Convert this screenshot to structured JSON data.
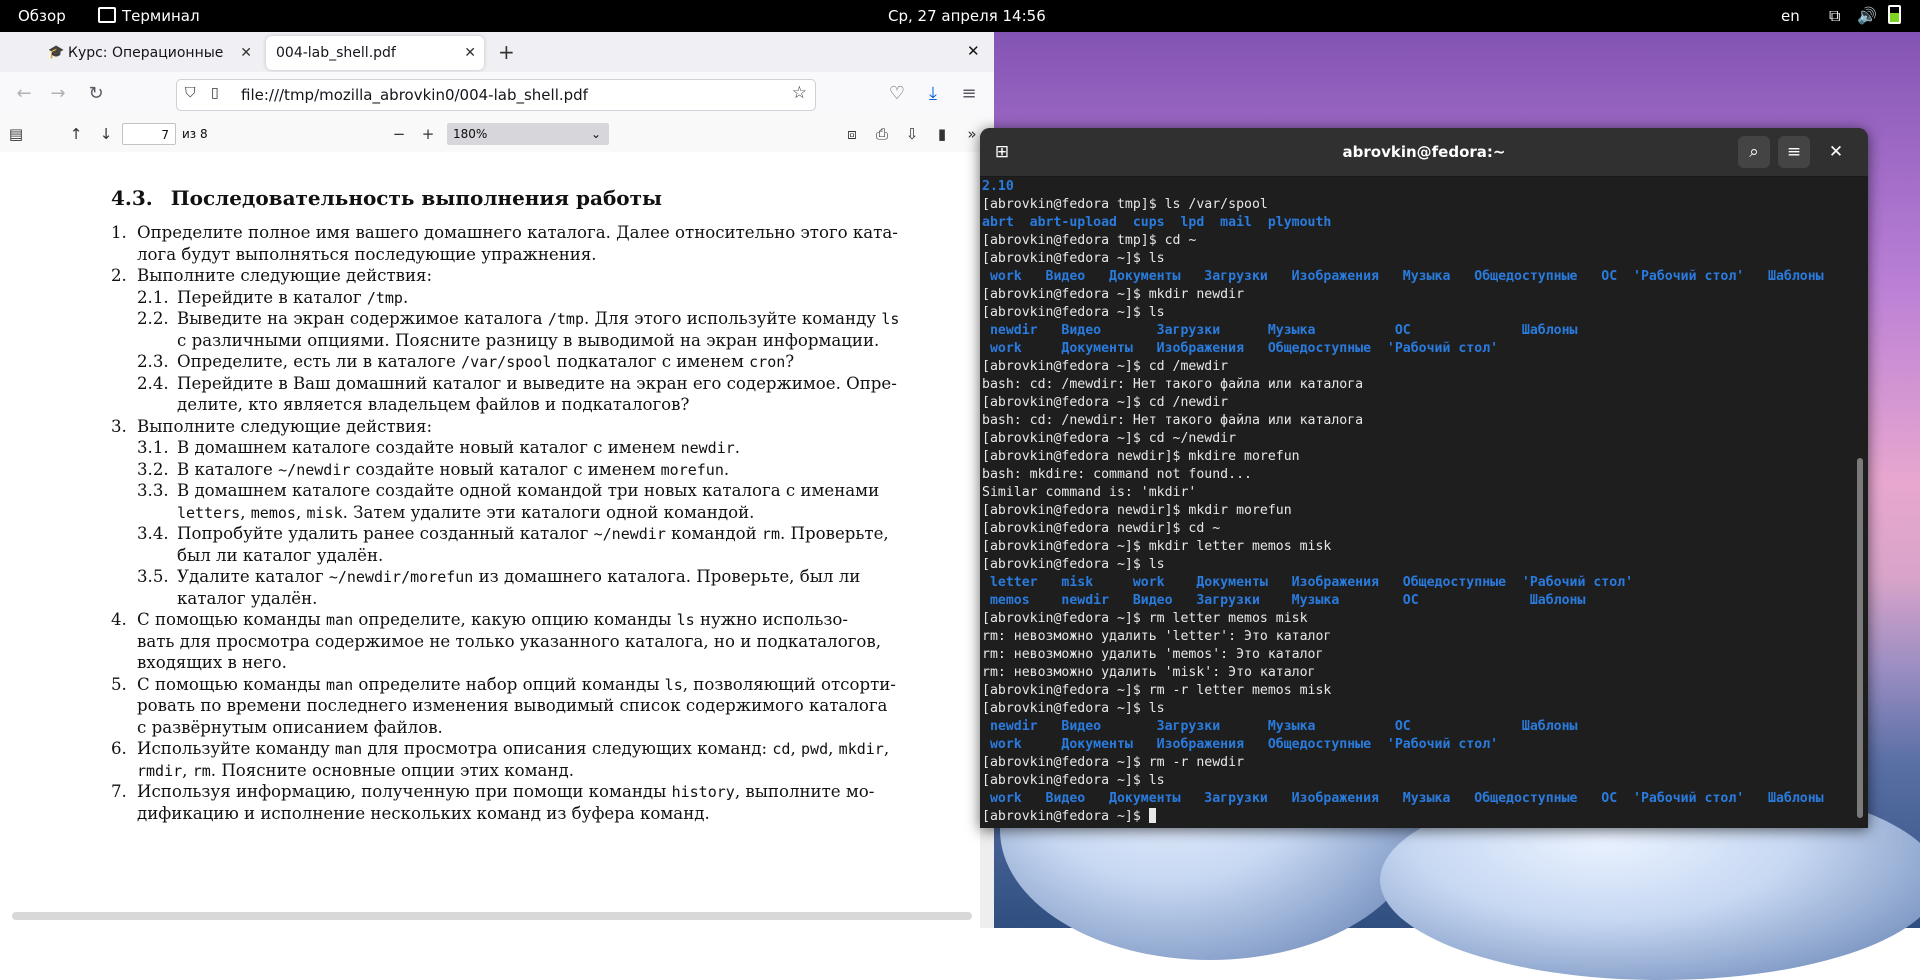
{
  "topbar": {
    "overview": "Обзор",
    "app_name": "Терминал",
    "datetime": "Ср, 27 апреля  14:56",
    "lang": "en"
  },
  "firefox": {
    "tab1_label": "Курс: Операционные сис",
    "tab2_label": "004-lab_shell.pdf",
    "url": "file:///tmp/mozilla_abrovkin0/004-lab_shell.pdf"
  },
  "pdf_toolbar": {
    "page_current": "7",
    "page_total": "из 8",
    "zoom": "180%"
  },
  "pdf": {
    "section_number": "4.3.",
    "section_title": "Последовательность выполнения работы",
    "lines": [
      {
        "num": "1.",
        "parts": [
          {
            "t": "Определите полное имя вашего домашнего каталога. Далее относительно этого ката-"
          }
        ]
      },
      {
        "num": "",
        "parts": [
          {
            "t": "лога будут выполняться последующие упражнения."
          }
        ]
      },
      {
        "num": "2.",
        "parts": [
          {
            "t": "Выполните следующие действия:"
          }
        ]
      },
      {
        "num": "2.1.",
        "parts": [
          {
            "t": "Перейдите в каталог "
          },
          {
            "t": "/tmp",
            "m": true
          },
          {
            "t": "."
          }
        ]
      },
      {
        "num": "2.2.",
        "parts": [
          {
            "t": "Выведите на экран содержимое каталога "
          },
          {
            "t": "/tmp",
            "m": true
          },
          {
            "t": ". Для этого используйте команду "
          },
          {
            "t": "ls",
            "m": true
          }
        ]
      },
      {
        "num": "",
        "parts": [
          {
            "t": "с различными опциями. Поясните разницу в выводимой на экран информации."
          }
        ]
      },
      {
        "num": "2.3.",
        "parts": [
          {
            "t": "Определите, есть ли в каталоге "
          },
          {
            "t": "/var/spool",
            "m": true
          },
          {
            "t": " подкаталог с именем "
          },
          {
            "t": "cron",
            "m": true
          },
          {
            "t": "?"
          }
        ]
      },
      {
        "num": "2.4.",
        "parts": [
          {
            "t": "Перейдите в Ваш домашний каталог и выведите на экран его содержимое. Опре-"
          }
        ]
      },
      {
        "num": "",
        "parts": [
          {
            "t": "делите, кто является владельцем файлов и подкаталогов?"
          }
        ]
      },
      {
        "num": "3.",
        "parts": [
          {
            "t": "Выполните следующие действия:"
          }
        ]
      },
      {
        "num": "3.1.",
        "parts": [
          {
            "t": "В домашнем каталоге создайте новый каталог с именем "
          },
          {
            "t": "newdir",
            "m": true
          },
          {
            "t": "."
          }
        ]
      },
      {
        "num": "3.2.",
        "parts": [
          {
            "t": "В каталоге "
          },
          {
            "t": "~/newdir",
            "m": true
          },
          {
            "t": " создайте новый каталог с именем "
          },
          {
            "t": "morefun",
            "m": true
          },
          {
            "t": "."
          }
        ]
      },
      {
        "num": "3.3.",
        "parts": [
          {
            "t": "В домашнем каталоге создайте одной командой три новых каталога с именами"
          }
        ]
      },
      {
        "num": "",
        "parts": [
          {
            "t": "letters",
            "m": true
          },
          {
            "t": ", "
          },
          {
            "t": "memos",
            "m": true
          },
          {
            "t": ", "
          },
          {
            "t": "misk",
            "m": true
          },
          {
            "t": ". Затем удалите эти каталоги одной командой."
          }
        ]
      },
      {
        "num": "3.4.",
        "parts": [
          {
            "t": "Попробуйте удалить ранее созданный каталог "
          },
          {
            "t": "~/newdir",
            "m": true
          },
          {
            "t": " командой "
          },
          {
            "t": "rm",
            "m": true
          },
          {
            "t": ". Проверьте,"
          }
        ]
      },
      {
        "num": "",
        "parts": [
          {
            "t": "был ли каталог удалён."
          }
        ]
      },
      {
        "num": "3.5.",
        "parts": [
          {
            "t": "Удалите каталог "
          },
          {
            "t": "~/newdir/morefun",
            "m": true
          },
          {
            "t": " из домашнего каталога. Проверьте, был ли"
          }
        ]
      },
      {
        "num": "",
        "parts": [
          {
            "t": "каталог удалён."
          }
        ]
      },
      {
        "num": "4.",
        "parts": [
          {
            "t": "С помощью команды "
          },
          {
            "t": "man",
            "m": true
          },
          {
            "t": " определите, какую опцию команды "
          },
          {
            "t": "ls",
            "m": true
          },
          {
            "t": " нужно использо-"
          }
        ]
      },
      {
        "num": "",
        "parts": [
          {
            "t": "вать для просмотра содержимое не только указанного каталога, но и подкаталогов,"
          }
        ]
      },
      {
        "num": "",
        "parts": [
          {
            "t": "входящих в него."
          }
        ]
      },
      {
        "num": "5.",
        "parts": [
          {
            "t": "С помощью команды "
          },
          {
            "t": "man",
            "m": true
          },
          {
            "t": " определите набор опций команды "
          },
          {
            "t": "ls",
            "m": true
          },
          {
            "t": ", позволяющий отсорти-"
          }
        ]
      },
      {
        "num": "",
        "parts": [
          {
            "t": "ровать по времени последнего изменения выводимый список содержимого каталога"
          }
        ]
      },
      {
        "num": "",
        "parts": [
          {
            "t": "с развёрнутым описанием файлов."
          }
        ]
      },
      {
        "num": "6.",
        "parts": [
          {
            "t": "Используйте команду "
          },
          {
            "t": "man",
            "m": true
          },
          {
            "t": " для просмотра описания следующих команд: "
          },
          {
            "t": "cd",
            "m": true
          },
          {
            "t": ", "
          },
          {
            "t": "pwd",
            "m": true
          },
          {
            "t": ", "
          },
          {
            "t": "mkdir",
            "m": true
          },
          {
            "t": ","
          }
        ]
      },
      {
        "num": "",
        "parts": [
          {
            "t": "rmdir",
            "m": true
          },
          {
            "t": ", "
          },
          {
            "t": "rm",
            "m": true
          },
          {
            "t": ". Поясните основные опции этих команд."
          }
        ]
      },
      {
        "num": "7.",
        "parts": [
          {
            "t": "Используя информацию, полученную при помощи команды "
          },
          {
            "t": "history",
            "m": true
          },
          {
            "t": ", выполните мо-"
          }
        ]
      },
      {
        "num": "",
        "parts": [
          {
            "t": "дификацию и исполнение нескольких команд из буфера команд."
          }
        ]
      }
    ]
  },
  "terminal": {
    "title": "abrovkin@fedora:~",
    "lines": [
      {
        "parts": [
          {
            "t": "2.10",
            "c": "blue"
          }
        ]
      },
      {
        "parts": [
          {
            "t": "[abrovkin@fedora tmp]$ ls /var/spool"
          }
        ]
      },
      {
        "parts": [
          {
            "t": "abrt  abrt-upload  cups  lpd  mail  plymouth",
            "c": "blue"
          }
        ]
      },
      {
        "parts": [
          {
            "t": "[abrovkin@fedora tmp]$ cd ~"
          }
        ]
      },
      {
        "parts": [
          {
            "t": "[abrovkin@fedora ~]$ ls"
          }
        ]
      },
      {
        "parts": [
          {
            "t": " work   Видео   Документы   Загрузки   Изображения   Музыка   Общедоступные   ОС  'Рабочий стол'   Шаблоны",
            "c": "blue"
          }
        ]
      },
      {
        "parts": [
          {
            "t": "[abrovkin@fedora ~]$ mkdir newdir"
          }
        ]
      },
      {
        "parts": [
          {
            "t": "[abrovkin@fedora ~]$ ls"
          }
        ]
      },
      {
        "parts": [
          {
            "t": " newdir   Видео       Загрузки      Музыка          ОС              Шаблоны",
            "c": "blue"
          }
        ]
      },
      {
        "parts": [
          {
            "t": " work     Документы   Изображения   Общедоступные  'Рабочий стол'",
            "c": "blue"
          }
        ]
      },
      {
        "parts": [
          {
            "t": "[abrovkin@fedora ~]$ cd /mewdir"
          }
        ]
      },
      {
        "parts": [
          {
            "t": "bash: cd: /mewdir: Нет такого файла или каталога"
          }
        ]
      },
      {
        "parts": [
          {
            "t": "[abrovkin@fedora ~]$ cd /newdir"
          }
        ]
      },
      {
        "parts": [
          {
            "t": "bash: cd: /newdir: Нет такого файла или каталога"
          }
        ]
      },
      {
        "parts": [
          {
            "t": "[abrovkin@fedora ~]$ cd ~/newdir"
          }
        ]
      },
      {
        "parts": [
          {
            "t": "[abrovkin@fedora newdir]$ mkdire morefun"
          }
        ]
      },
      {
        "parts": [
          {
            "t": "bash: mkdire: command not found..."
          }
        ]
      },
      {
        "parts": [
          {
            "t": "Similar command is: 'mkdir'"
          }
        ]
      },
      {
        "parts": [
          {
            "t": "[abrovkin@fedora newdir]$ mkdir morefun"
          }
        ]
      },
      {
        "parts": [
          {
            "t": "[abrovkin@fedora newdir]$ cd ~"
          }
        ]
      },
      {
        "parts": [
          {
            "t": "[abrovkin@fedora ~]$ mkdir letter memos misk"
          }
        ]
      },
      {
        "parts": [
          {
            "t": "[abrovkin@fedora ~]$ ls"
          }
        ]
      },
      {
        "parts": [
          {
            "t": " letter   misk     work    Документы   Изображения   Общедоступные  'Рабочий стол'",
            "c": "blue"
          }
        ]
      },
      {
        "parts": [
          {
            "t": " memos    newdir   Видео   Загрузки    Музыка        ОС              Шаблоны",
            "c": "blue"
          }
        ]
      },
      {
        "parts": [
          {
            "t": "[abrovkin@fedora ~]$ rm letter memos misk"
          }
        ]
      },
      {
        "parts": [
          {
            "t": "rm: невозможно удалить 'letter': Это каталог"
          }
        ]
      },
      {
        "parts": [
          {
            "t": "rm: невозможно удалить 'memos': Это каталог"
          }
        ]
      },
      {
        "parts": [
          {
            "t": "rm: невозможно удалить 'misk': Это каталог"
          }
        ]
      },
      {
        "parts": [
          {
            "t": "[abrovkin@fedora ~]$ rm -r letter memos misk"
          }
        ]
      },
      {
        "parts": [
          {
            "t": "[abrovkin@fedora ~]$ ls"
          }
        ]
      },
      {
        "parts": [
          {
            "t": " newdir   Видео       Загрузки      Музыка          ОС              Шаблоны",
            "c": "blue"
          }
        ]
      },
      {
        "parts": [
          {
            "t": " work     Документы   Изображения   Общедоступные  'Рабочий стол'",
            "c": "blue"
          }
        ]
      },
      {
        "parts": [
          {
            "t": "[abrovkin@fedora ~]$ rm -r newdir"
          }
        ]
      },
      {
        "parts": [
          {
            "t": "[abrovkin@fedora ~]$ ls"
          }
        ]
      },
      {
        "parts": [
          {
            "t": " work   Видео   Документы   Загрузки   Изображения   Музыка   Общедоступные   ОС  'Рабочий стол'   Шаблоны",
            "c": "blue"
          }
        ]
      },
      {
        "parts": [
          {
            "t": "[abrovkin@fedora ~]$ "
          }
        ],
        "cursor": true
      }
    ]
  }
}
